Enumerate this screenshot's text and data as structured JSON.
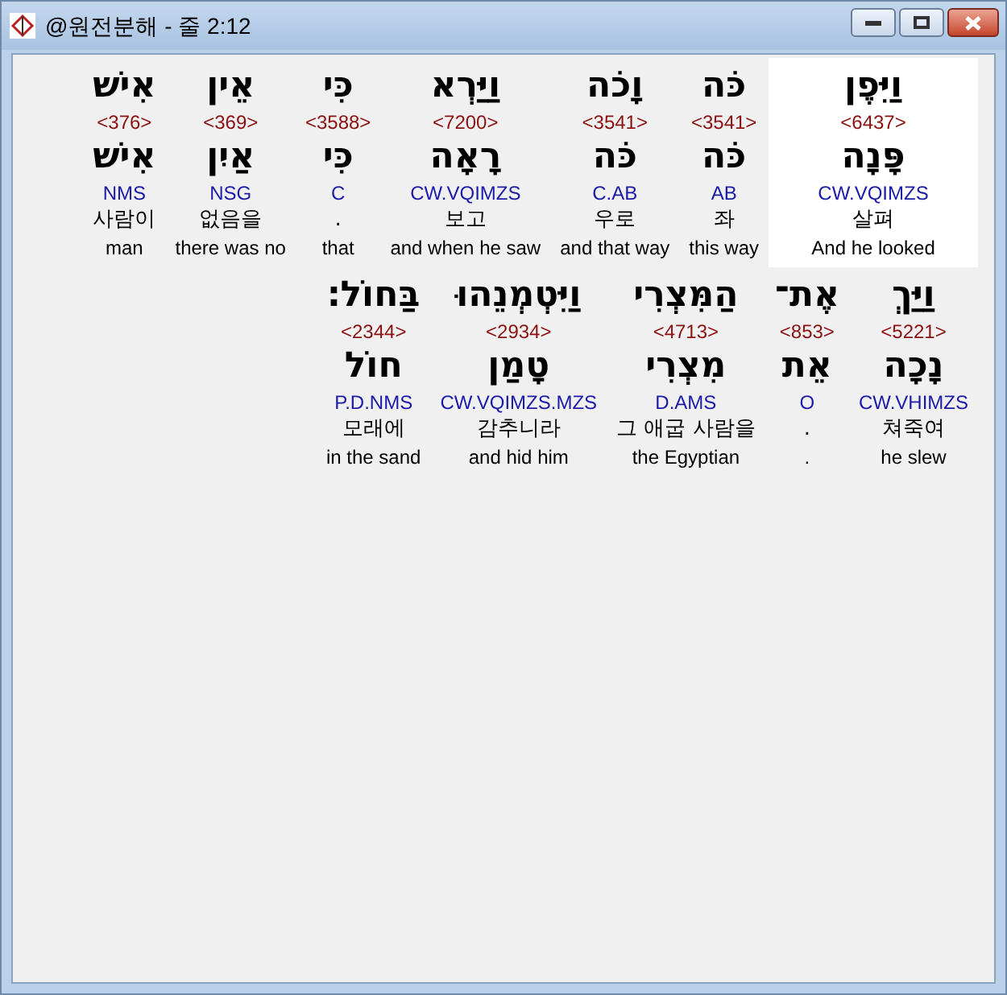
{
  "window": {
    "title": "@원전분해 - 줄 2:12"
  },
  "words": [
    {
      "hebrew": "וַיִּפֶן",
      "strong": "<6437>",
      "lemma": "פָּנָה",
      "parsing": "CW.VQIMZS",
      "korean": "살펴",
      "english": "And he looked",
      "selected": true
    },
    {
      "hebrew": "כֹּה",
      "strong": "<3541>",
      "lemma": "כֹּה",
      "parsing": "AB",
      "korean": "좌",
      "english": "this way",
      "selected": false
    },
    {
      "hebrew": "וָכֹה",
      "strong": "<3541>",
      "lemma": "כֹּה",
      "parsing": "C.AB",
      "korean": "우로",
      "english": "and that way",
      "selected": false
    },
    {
      "hebrew": "וַיַּרְא",
      "strong": "<7200>",
      "lemma": "רָאָה",
      "parsing": "CW.VQIMZS",
      "korean": "보고",
      "english": "and when he saw",
      "selected": false
    },
    {
      "hebrew": "כִּי",
      "strong": "<3588>",
      "lemma": "כִּי",
      "parsing": "C",
      "korean": ".",
      "english": "that",
      "selected": false
    },
    {
      "hebrew": "אֵין",
      "strong": "<369>",
      "lemma": "אַיִן",
      "parsing": "NSG",
      "korean": "없음을",
      "english": "there was no",
      "selected": false
    },
    {
      "hebrew": "אִישׁ",
      "strong": "<376>",
      "lemma": "אִישׁ",
      "parsing": "NMS",
      "korean": "사람이",
      "english": "man",
      "selected": false
    },
    {
      "hebrew": "וַיַּךְ",
      "strong": "<5221>",
      "lemma": "נָכָה",
      "parsing": "CW.VHIMZS",
      "korean": "쳐죽여",
      "english": "he slew",
      "selected": false
    },
    {
      "hebrew": "אֶת־",
      "strong": "<853>",
      "lemma": "אֵת",
      "parsing": "O",
      "korean": ".",
      "english": ".",
      "selected": false
    },
    {
      "hebrew": "הַמִּצְרִי",
      "strong": "<4713>",
      "lemma": "מִצְרִי",
      "parsing": "D.AMS",
      "korean": "그 애굽 사람을",
      "english": "the Egyptian",
      "selected": false
    },
    {
      "hebrew": "וַיִּטְמְנֵהוּ",
      "strong": "<2934>",
      "lemma": "טָמַן",
      "parsing": "CW.VQIMZS.MZS",
      "korean": "감추니라",
      "english": "and hid him",
      "selected": false
    },
    {
      "hebrew": "בַּחוֹל׃",
      "strong": "<2344>",
      "lemma": "חוֹל",
      "parsing": "P.D.NMS",
      "korean": "모래에",
      "english": "in the sand",
      "selected": false
    }
  ]
}
